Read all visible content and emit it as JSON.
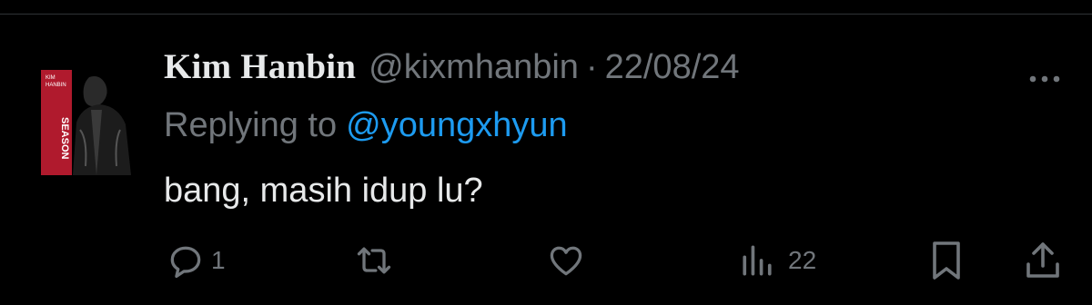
{
  "tweet": {
    "author_name": "Kim Hanbin",
    "handle": "@kixmhanbin",
    "separator": "·",
    "date": "22/08/24",
    "replying_prefix": "Replying to",
    "replying_to": "@youngxhyun",
    "text": "bang, masih idup lu?",
    "avatar_text": {
      "line1": "KIM",
      "line2": "HANBIN",
      "vertical": "SEASON"
    }
  },
  "actions": {
    "reply_count": "1",
    "retweet_count": "",
    "like_count": "",
    "views_count": "22"
  },
  "icons": {
    "more": "more-options-icon",
    "reply": "reply-bubble-icon",
    "retweet": "retweet-icon",
    "like": "heart-icon",
    "views": "views-bar-chart-icon",
    "bookmark": "bookmark-icon",
    "share": "share-upload-icon"
  },
  "colors": {
    "background": "#000000",
    "text_primary": "#e7e9ea",
    "text_secondary": "#71767b",
    "accent": "#1d9bf0",
    "avatar_red": "#b01a2d"
  }
}
